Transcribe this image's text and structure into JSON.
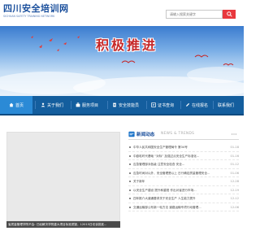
{
  "header": {
    "logo_cn": "四川安全培训网",
    "logo_en": "SICHUAN SAFETY TRAINING NETWORK",
    "search_placeholder": "请输入搜索关键字"
  },
  "banner": {
    "slogan": "积极推进"
  },
  "nav": {
    "items": [
      {
        "label": "首页",
        "active": true
      },
      {
        "label": "关于我们"
      },
      {
        "label": "服务项目"
      },
      {
        "label": "安全技能员"
      },
      {
        "label": "证书查询"
      },
      {
        "label": "在线报名"
      },
      {
        "label": "联系我们"
      }
    ]
  },
  "slider": {
    "caption": "省质量管理学院不会: 已经解决学院重大项目标准质疑，12015日访谈批准..."
  },
  "news": {
    "title": "新闻动态",
    "title_en": "NEWS & TRENDS",
    "items": [
      {
        "text": "中华人民共和国安全生产管理局令 第34号",
        "date": "01-18"
      },
      {
        "text": "中欧哈时代基础 “对标” 加强过点安全生产标准化...",
        "date": "01-16"
      },
      {
        "text": "应急管理部对各级 注意安全检查 安全...",
        "date": "01-12"
      },
      {
        "text": "应急时间对以外，安全管理是以上 日行确定质量管理安全...",
        "date": "01-06"
      },
      {
        "text": "关于新年",
        "date": "12-28"
      },
      {
        "text": "以安全生产建设 提升和重视 作出对省进行市场...",
        "date": "12-19"
      },
      {
        "text": "四年推介大道通要求关于安全生产 人生能力提升",
        "date": "12-12"
      },
      {
        "text": "交通运输部公布新一轮方法 道路运输专项行动管理...",
        "date": "12-06"
      }
    ]
  }
}
